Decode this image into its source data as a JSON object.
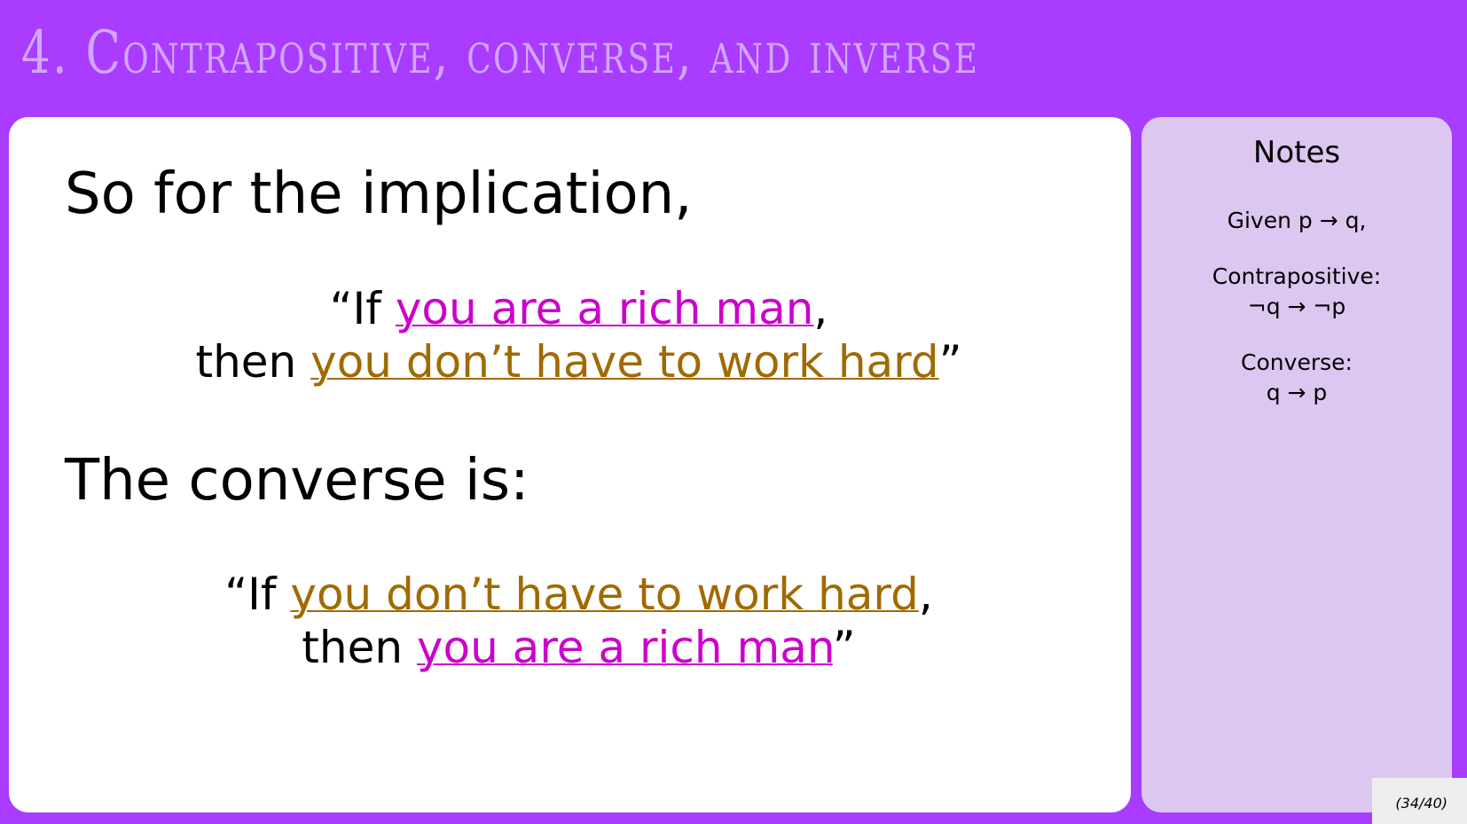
{
  "slide": {
    "title": "4. Contrapositive, converse, and inverse",
    "page_indicator": "(34/40)"
  },
  "main": {
    "heading1": "So for the implication,",
    "implication": {
      "open": "“If ",
      "p": "you are a rich man",
      "comma": ",",
      "then": "then ",
      "q": "you don’t have to work hard",
      "close": "”"
    },
    "heading2": "The converse is:",
    "converse": {
      "open": "“If ",
      "q": "you don’t have to work hard",
      "comma": ",",
      "then": "then ",
      "p": "you are a rich man",
      "close": "”"
    }
  },
  "notes": {
    "title": "Notes",
    "given": "Given p → q,",
    "contrapositive_label": "Contrapositive:",
    "contrapositive_formula": "¬q → ¬p",
    "converse_label": "Converse:",
    "converse_formula": "q → p"
  },
  "colors": {
    "background": "#a93cff",
    "title": "#d2a6ff",
    "p_clause": "#cc00cc",
    "q_clause": "#a06a00",
    "notes_panel": "#dcc7f1"
  }
}
